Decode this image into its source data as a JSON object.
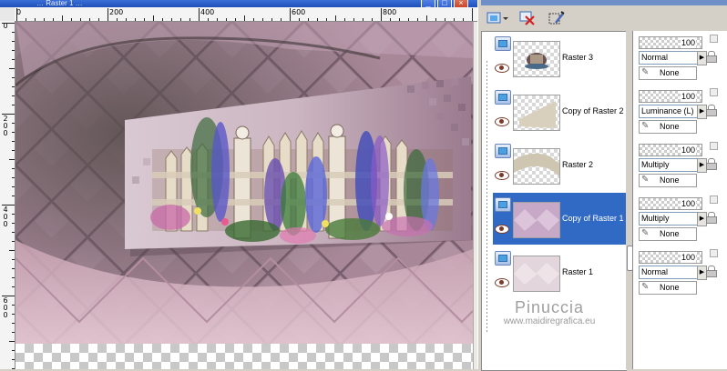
{
  "window": {
    "title": "… Raster 1 …",
    "buttons": [
      "minimize",
      "maximize",
      "close"
    ]
  },
  "ruler": {
    "top_labels": [
      "0",
      "200",
      "400",
      "600",
      "800"
    ],
    "left_labels": [
      "0",
      "2 0 0",
      "4 0 0",
      "6 0 0"
    ]
  },
  "toolbar": {
    "icons": [
      "new-layer-icon",
      "delete-layer-icon",
      "properties-icon"
    ]
  },
  "layers": [
    {
      "name": "Raster 3",
      "selected": false,
      "opacity": "100",
      "blend": "Normal",
      "mask": "None"
    },
    {
      "name": "Copy of Raster 2",
      "selected": false,
      "opacity": "100",
      "blend": "Luminance (L)",
      "mask": "None"
    },
    {
      "name": "Raster 2",
      "selected": false,
      "opacity": "100",
      "blend": "Multiply",
      "mask": "None"
    },
    {
      "name": "Copy of Raster 1",
      "selected": true,
      "opacity": "100",
      "blend": "Multiply",
      "mask": "None"
    },
    {
      "name": "Raster 1",
      "selected": false,
      "opacity": "100",
      "blend": "Normal",
      "mask": "None"
    }
  ],
  "watermark": {
    "name": "Pinuccia",
    "url": "www.maidiregrafica.eu"
  },
  "colors": {
    "selection": "#316ac5",
    "canvas_main": "#a98a9c",
    "canvas_pink": "#d9b7c2"
  }
}
